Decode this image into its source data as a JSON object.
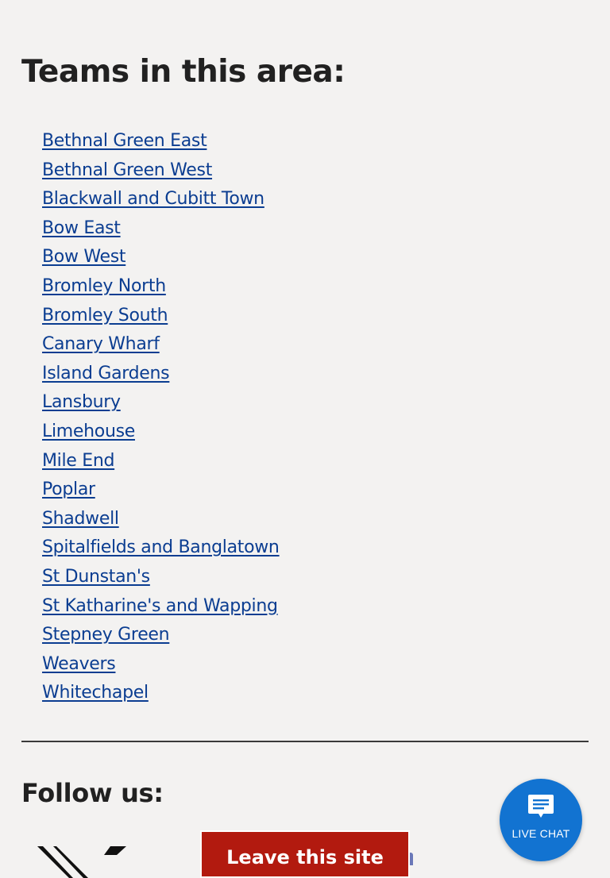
{
  "teams_section": {
    "title": "Teams in this area:",
    "teams": [
      "Bethnal Green East",
      "Bethnal Green West",
      "Blackwall and Cubitt Town",
      "Bow East",
      "Bow West",
      "Bromley North",
      "Bromley South",
      "Canary Wharf",
      "Island Gardens",
      "Lansbury",
      "Limehouse",
      "Mile End",
      "Poplar",
      "Shadwell",
      "Spitalfields and Banglatown",
      "St Dunstan's",
      "St Katharine's and Wapping",
      "Stepney Green",
      "Weavers",
      "Whitechapel"
    ]
  },
  "follow_section": {
    "title": "Follow us:",
    "social_icon": "x-logo-icon"
  },
  "leave_site": {
    "label": "Leave this site"
  },
  "live_chat": {
    "label": "LIVE CHAT",
    "icon": "chat-bubble-icon"
  },
  "colors": {
    "background": "#f3f2f1",
    "link": "#0b3d91",
    "leave_button": "#b21a0f",
    "live_chat": "#1273d1",
    "text": "#212121"
  }
}
